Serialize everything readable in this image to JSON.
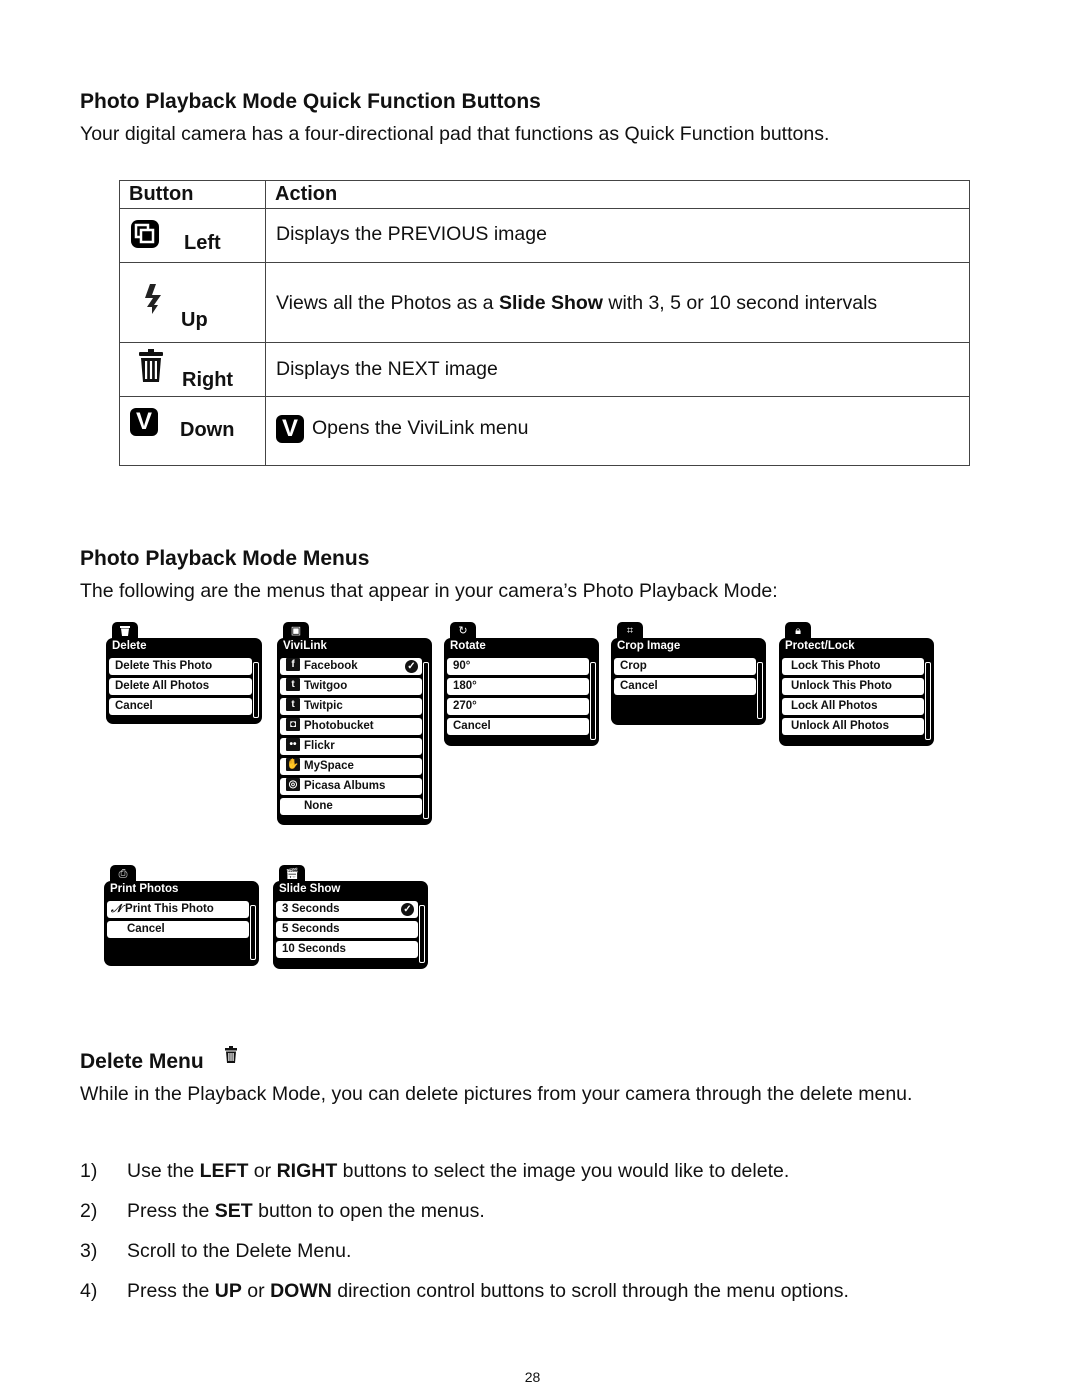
{
  "section1": {
    "title": "Photo Playback Mode Quick Function Buttons",
    "intro": "Your digital camera has a four-directional pad that functions as Quick Function buttons.",
    "table": {
      "headers": [
        "Button",
        "Action"
      ],
      "rows": [
        {
          "icon": "previous-image-icon",
          "button": "Left",
          "action": "Displays the PREVIOUS image"
        },
        {
          "icon": "flash-icon",
          "button": "Up",
          "action_pre": "Views all the Photos as a ",
          "action_bold": "Slide Show",
          "action_post": " with 3, 5 or 10 second intervals"
        },
        {
          "icon": "trash-icon",
          "button": "Right",
          "action": "Displays the NEXT image"
        },
        {
          "icon": "vivilink-icon",
          "button": "Down",
          "icon_glyph": "V",
          "action": "Opens the ViviLink menu"
        }
      ]
    }
  },
  "section2": {
    "title": "Photo Playback Mode Menus",
    "intro": "The following are the menus that appear in your camera’s Photo Playback Mode:",
    "menus": [
      {
        "title": "Delete",
        "tab_icon": "trash-icon",
        "items": [
          "Delete This Photo",
          "Delete All Photos",
          "Cancel"
        ]
      },
      {
        "title": "ViviLink",
        "tab_icon": "vivilink-icon",
        "items": [
          "Facebook",
          "Twitgoo",
          "Twitpic",
          "Photobucket",
          "Flickr",
          "MySpace",
          "Picasa Albums",
          "None"
        ],
        "selected": "Facebook"
      },
      {
        "title": "Rotate",
        "tab_icon": "rotate-icon",
        "items": [
          "90°",
          "180°",
          "270°",
          "Cancel"
        ]
      },
      {
        "title": "Crop Image",
        "tab_icon": "crop-icon",
        "items": [
          "Crop",
          "Cancel"
        ]
      },
      {
        "title": "Protect/Lock",
        "tab_icon": "lock-icon",
        "items": [
          "Lock This Photo",
          "Unlock This Photo",
          "Lock All Photos",
          "Unlock All Photos"
        ]
      },
      {
        "title": "Print Photos",
        "tab_icon": "print-icon",
        "items": [
          "Print This Photo",
          "Cancel"
        ]
      },
      {
        "title": "Slide Show",
        "tab_icon": "slideshow-icon",
        "items": [
          "3 Seconds",
          "5 Seconds",
          "10 Seconds"
        ],
        "selected": "3 Seconds"
      }
    ]
  },
  "section3": {
    "title": "Delete Menu",
    "intro": "While in the Playback Mode, you can delete pictures from your camera through the delete menu.",
    "steps": [
      {
        "num": "1)",
        "parts": [
          [
            "Use the ",
            false
          ],
          [
            "LEFT",
            true
          ],
          [
            " or ",
            false
          ],
          [
            "RIGHT",
            true
          ],
          [
            " buttons to select the image you would like to delete.",
            false
          ]
        ]
      },
      {
        "num": "2)",
        "parts": [
          [
            "Press the ",
            false
          ],
          [
            "SET",
            true
          ],
          [
            " button to open the menus.",
            false
          ]
        ]
      },
      {
        "num": "3)",
        "parts": [
          [
            "Scroll to the Delete Menu.",
            false
          ]
        ]
      },
      {
        "num": "4)",
        "parts": [
          [
            "Press the ",
            false
          ],
          [
            "UP",
            true
          ],
          [
            " or ",
            false
          ],
          [
            "DOWN",
            true
          ],
          [
            " direction control buttons to scroll through the menu options.",
            false
          ]
        ]
      }
    ]
  },
  "page_number": "28"
}
